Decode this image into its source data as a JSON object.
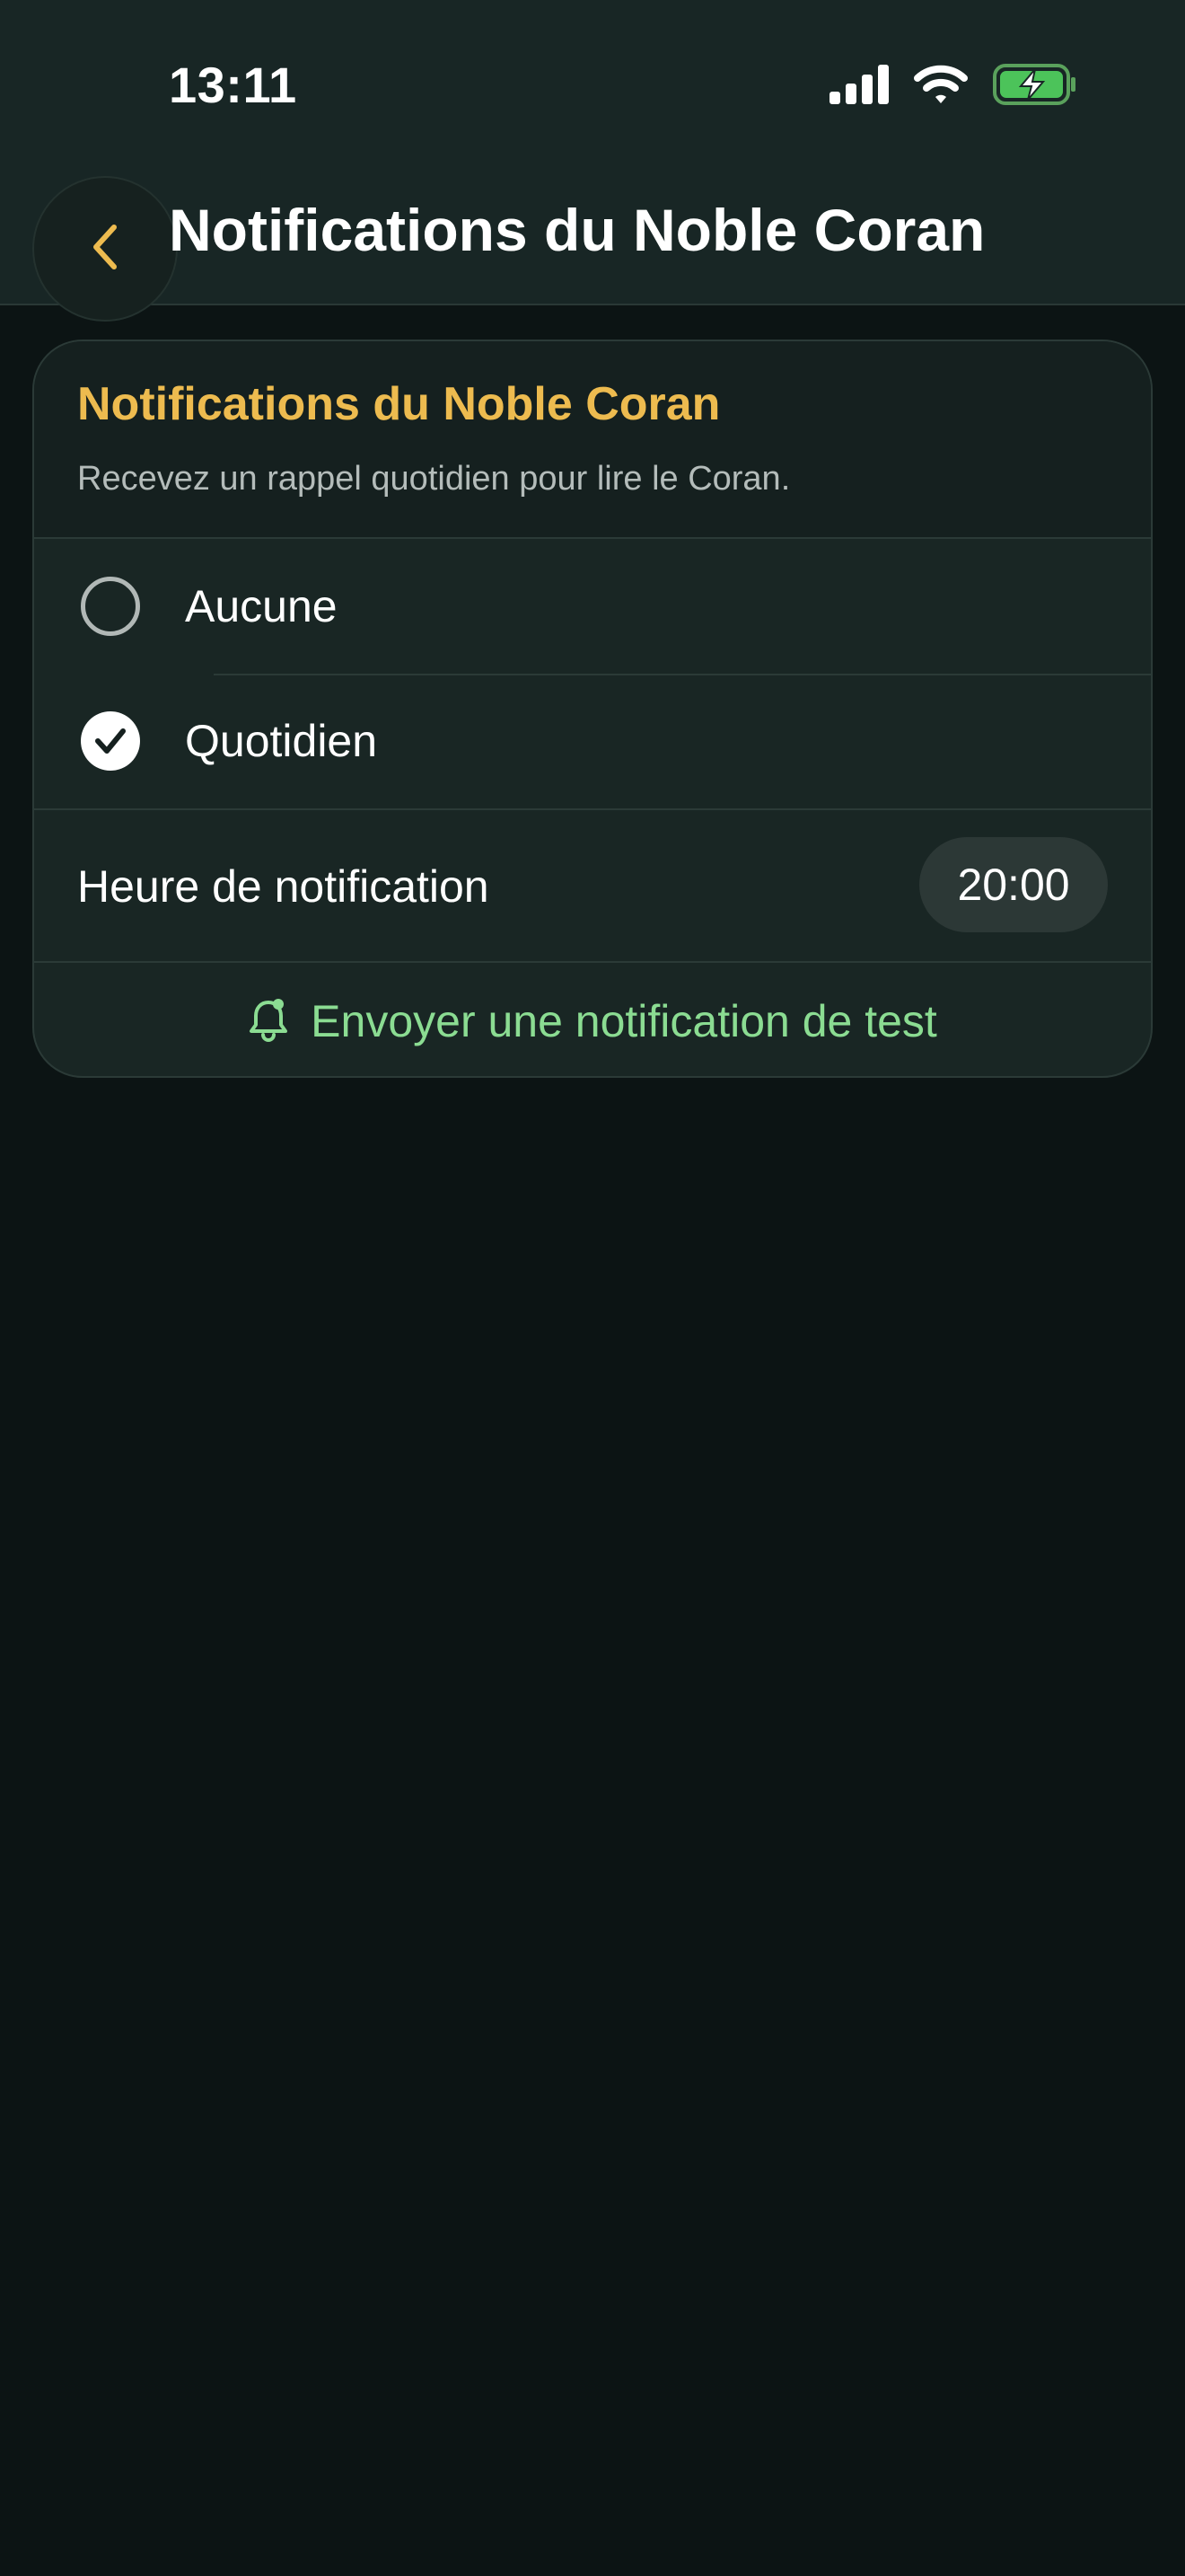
{
  "status_bar": {
    "time": "13:11",
    "icons": [
      "cellular-signal-icon",
      "wifi-icon",
      "battery-charging-icon"
    ]
  },
  "header": {
    "back_icon": "chevron-left-icon",
    "title": "Notifications du Noble Coran"
  },
  "card": {
    "title": "Notifications du Noble Coran",
    "subtitle": "Recevez un rappel quotidien pour lire le Coran.",
    "options": [
      {
        "label": "Aucune",
        "selected": false
      },
      {
        "label": "Quotidien",
        "selected": true
      }
    ],
    "time_setting": {
      "label": "Heure de notification",
      "value": "20:00"
    },
    "test_action": {
      "icon": "bell-icon",
      "label": "Envoyer une notification de test"
    }
  },
  "colors": {
    "accent_gold": "#edbb4f",
    "accent_green": "#8bdc92",
    "background": "#0c1414",
    "surface": "#192624"
  }
}
